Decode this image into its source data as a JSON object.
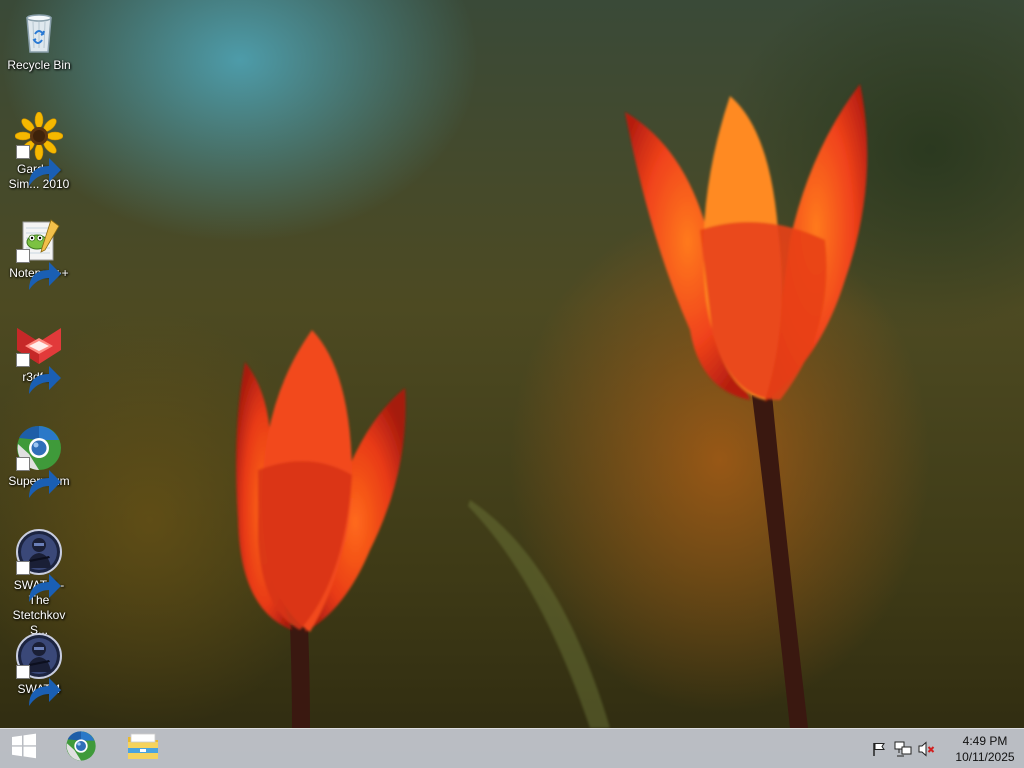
{
  "desktop": {
    "icons": [
      {
        "label": "Recycle Bin",
        "icon": "recycle-bin-icon",
        "shortcut": false
      },
      {
        "label": "Garden-Sim... 2010",
        "icon": "sunflower-icon",
        "shortcut": true
      },
      {
        "label": "Notepad++",
        "icon": "notepad-plus-plus-icon",
        "shortcut": true
      },
      {
        "label": "r3dfox",
        "icon": "r3dfox-icon",
        "shortcut": true
      },
      {
        "label": "Supermium",
        "icon": "supermium-icon",
        "shortcut": true
      },
      {
        "label": "SWAT 4 - The Stetchkov S...",
        "icon": "swat4-icon",
        "shortcut": true
      },
      {
        "label": "SWAT 4",
        "icon": "swat4-icon",
        "shortcut": true
      }
    ]
  },
  "taskbar": {
    "start_icon": "windows-logo-icon",
    "pinned": [
      {
        "icon": "supermium-icon"
      },
      {
        "icon": "file-explorer-icon"
      }
    ],
    "tray": {
      "icons": [
        "action-center-flag-icon",
        "network-icon",
        "volume-muted-icon"
      ],
      "time": "4:49 PM",
      "date": "10/11/2025"
    }
  }
}
